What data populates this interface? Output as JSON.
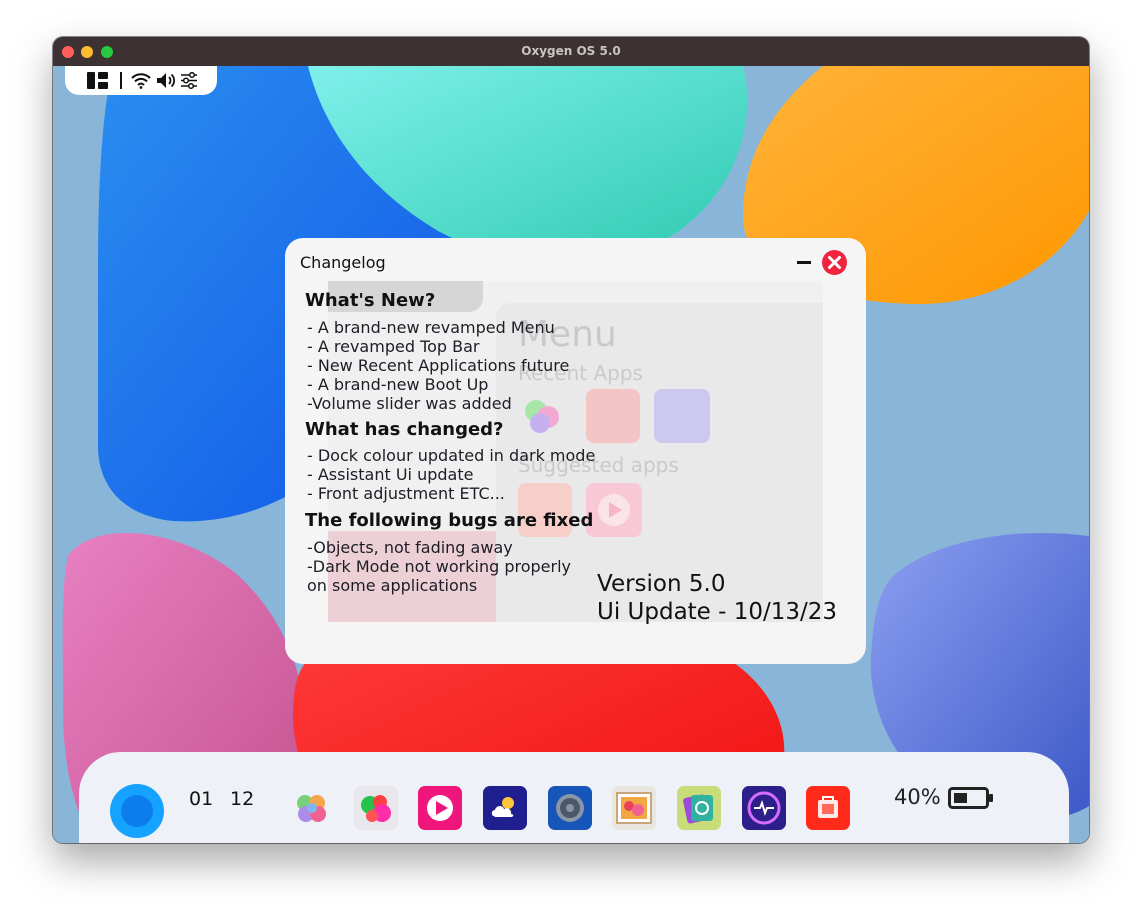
{
  "window": {
    "title": "Oxygen OS 5.0"
  },
  "status_bar": {
    "icons": [
      "layout-icon",
      "wifi-icon",
      "volume-icon",
      "sliders-icon"
    ]
  },
  "changelog": {
    "title": "Changelog",
    "sections": [
      {
        "heading": "What's New?",
        "items": [
          "- A brand-new revamped Menu",
          "- A revamped Top Bar",
          "- New Recent Applications future",
          "- A brand-new Boot Up",
          "-Volume slider was added"
        ]
      },
      {
        "heading": "What has changed?",
        "items": [
          "- Dock colour updated in dark mode",
          "- Assistant Ui update",
          "- Front adjustment ETC..."
        ]
      },
      {
        "heading": "The following bugs are fixed",
        "items": [
          "-Objects, not fading away",
          "-Dark Mode not working properly",
          "on some applications"
        ]
      }
    ],
    "version": "Version 5.0",
    "update": "Ui Update - 10/13/23"
  },
  "menu_preview": {
    "title": "Menu",
    "recent": "Recent Apps",
    "suggested": "Suggested apps"
  },
  "dock": {
    "assistant_icon": "assistant-orb-icon",
    "hour": "01",
    "minute": "12",
    "apps": [
      "photos-app-icon",
      "color-balls-app-icon",
      "music-player-app-icon",
      "weather-app-icon",
      "settings-app-icon",
      "gallery-app-icon",
      "security-app-icon",
      "monitor-app-icon",
      "store-app-icon"
    ],
    "battery": "40%"
  },
  "colors": {
    "titlebar": "#3d3233",
    "close_red": "#ff5f57",
    "dialog_close": "#f0243e",
    "assistant_blue": "#1aa4ff"
  }
}
